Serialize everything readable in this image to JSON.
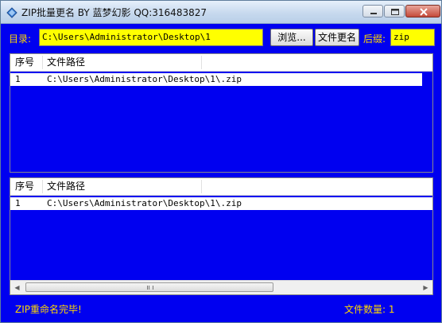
{
  "window": {
    "title": "ZIP批量更名 BY 蓝梦幻影 QQ:316483827"
  },
  "toolbar": {
    "dir_label": "目录:",
    "dir_value": "C:\\Users\\Administrator\\Desktop\\1",
    "browse_label": "浏览...",
    "rename_label": "文件更名",
    "suffix_label": "后缀:",
    "suffix_value": "zip"
  },
  "list_top": {
    "columns": [
      "序号",
      "文件路径"
    ],
    "rows": [
      {
        "index": "1",
        "path": "C:\\Users\\Administrator\\Desktop\\1\\.zip"
      }
    ]
  },
  "list_bottom": {
    "columns": [
      "序号",
      "文件路径"
    ],
    "rows": [
      {
        "index": "1",
        "path": "C:\\Users\\Administrator\\Desktop\\1\\.zip"
      }
    ],
    "scroll_grip": "|||"
  },
  "status": {
    "message": "ZIP重命名完毕!",
    "count_text": "文件数量: 1"
  },
  "colors": {
    "background": "#0000f0",
    "label": "#ffd800",
    "field": "#ffff00"
  }
}
